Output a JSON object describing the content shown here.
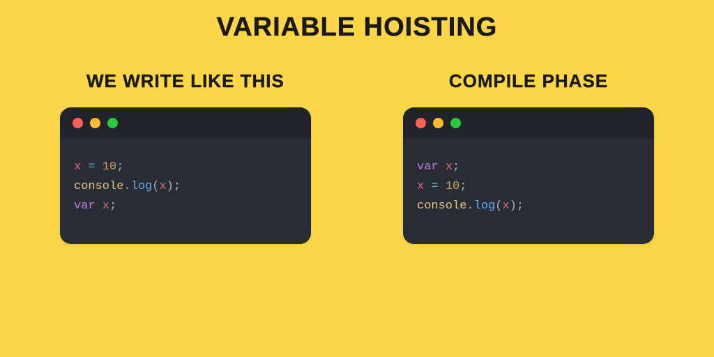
{
  "title": "VARIABLE HOISTING",
  "left": {
    "heading": "WE WRITE LIKE THIS",
    "code": [
      [
        {
          "cls": "tk-var",
          "t": "x"
        },
        {
          "cls": "tk-ident",
          "t": " "
        },
        {
          "cls": "tk-op",
          "t": "="
        },
        {
          "cls": "tk-ident",
          "t": " "
        },
        {
          "cls": "tk-num",
          "t": "10"
        },
        {
          "cls": "tk-punct",
          "t": ";"
        }
      ],
      [
        {
          "cls": "tk-obj",
          "t": "console"
        },
        {
          "cls": "tk-punct",
          "t": "."
        },
        {
          "cls": "tk-prop",
          "t": "log"
        },
        {
          "cls": "tk-punct",
          "t": "("
        },
        {
          "cls": "tk-var",
          "t": "x"
        },
        {
          "cls": "tk-punct",
          "t": ");"
        }
      ],
      [
        {
          "cls": "tk-key",
          "t": "var"
        },
        {
          "cls": "tk-ident",
          "t": " "
        },
        {
          "cls": "tk-var",
          "t": "x"
        },
        {
          "cls": "tk-punct",
          "t": ";"
        }
      ]
    ]
  },
  "right": {
    "heading": "COMPILE PHASE",
    "code": [
      [
        {
          "cls": "tk-key",
          "t": "var"
        },
        {
          "cls": "tk-ident",
          "t": " "
        },
        {
          "cls": "tk-var",
          "t": "x"
        },
        {
          "cls": "tk-punct",
          "t": ";"
        }
      ],
      [
        {
          "cls": "tk-var",
          "t": "x"
        },
        {
          "cls": "tk-ident",
          "t": " "
        },
        {
          "cls": "tk-op",
          "t": "="
        },
        {
          "cls": "tk-ident",
          "t": " "
        },
        {
          "cls": "tk-num",
          "t": "10"
        },
        {
          "cls": "tk-punct",
          "t": ";"
        }
      ],
      [
        {
          "cls": "tk-obj",
          "t": "console"
        },
        {
          "cls": "tk-punct",
          "t": "."
        },
        {
          "cls": "tk-prop",
          "t": "log"
        },
        {
          "cls": "tk-punct",
          "t": "("
        },
        {
          "cls": "tk-var",
          "t": "x"
        },
        {
          "cls": "tk-punct",
          "t": ");"
        }
      ]
    ]
  },
  "traffic": {
    "red": "#ff5f56",
    "yellow": "#ffbd2e",
    "green": "#27c93f"
  }
}
